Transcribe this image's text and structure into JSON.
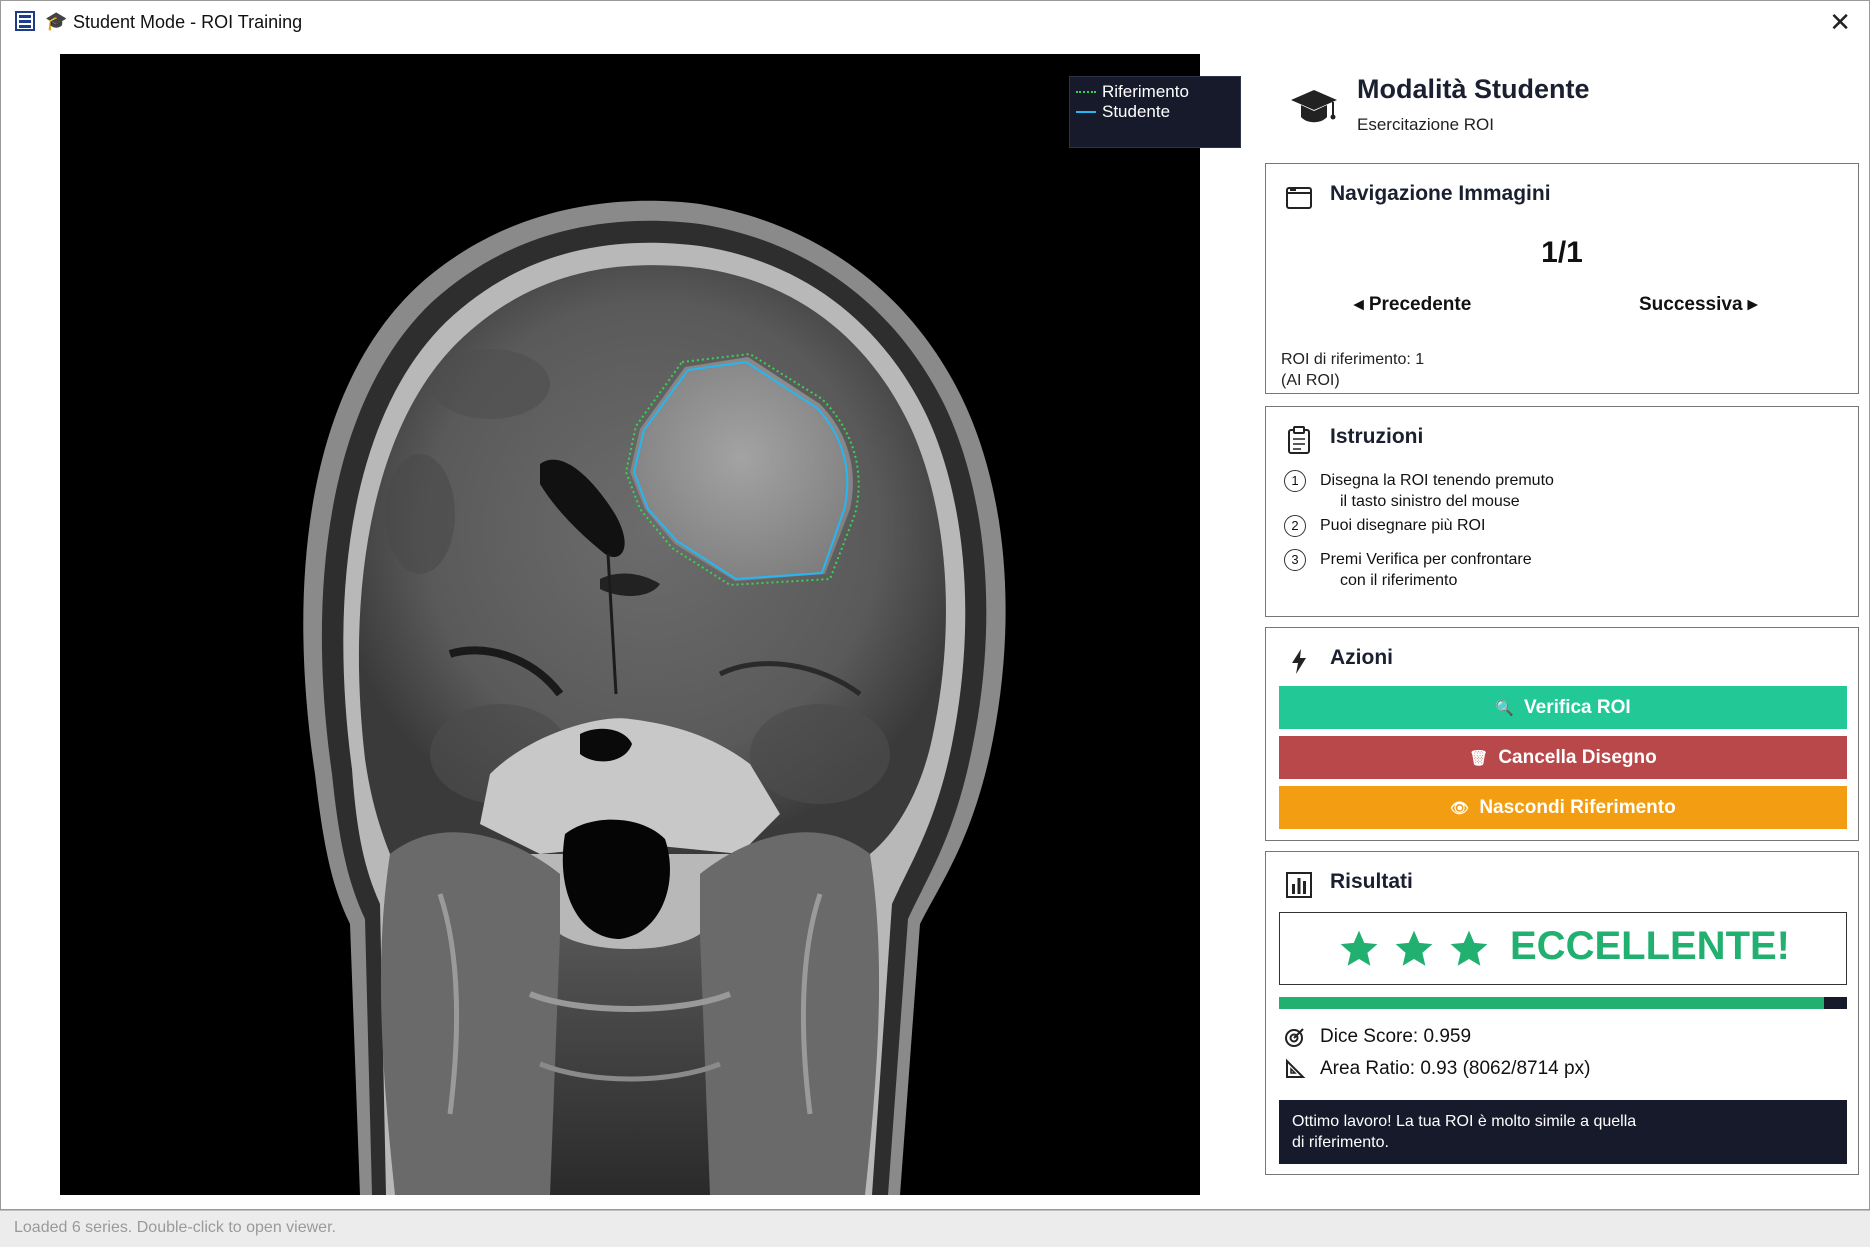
{
  "window": {
    "title": "Student Mode - ROI Training",
    "title_icon": "graduation-cap-icon",
    "close_label": "✕"
  },
  "viewer": {
    "legend": {
      "reference_label": "Riferimento",
      "student_label": "Studente",
      "reference_color": "#39d353",
      "student_color": "#27b6f0"
    }
  },
  "header": {
    "title": "Modalità Studente",
    "subtitle": "Esercitazione ROI",
    "icon": "graduation-cap-icon"
  },
  "navigation": {
    "title": "Navigazione Immagini",
    "counter": "1/1",
    "prev_label": "◂  Precedente",
    "next_label": "Successiva  ▸",
    "roi_info_line1": "ROI di riferimento: 1",
    "roi_info_line2": "(AI ROI)"
  },
  "instructions": {
    "title": "Istruzioni",
    "steps": [
      {
        "num": "1",
        "line1": "Disegna la ROI tenendo premuto",
        "line2": "il tasto sinistro del mouse"
      },
      {
        "num": "2",
        "line1": "Puoi disegnare più ROI",
        "line2": ""
      },
      {
        "num": "3",
        "line1": "Premi Verifica per confrontare",
        "line2": "con il riferimento"
      }
    ]
  },
  "actions": {
    "title": "Azioni",
    "verify_label": "Verifica ROI",
    "clear_label": "Cancella Disegno",
    "hide_label": "Nascondi Riferimento",
    "verify_color": "#22c997",
    "clear_color": "#b9484a",
    "hide_color": "#f29d12"
  },
  "results": {
    "title": "Risultati",
    "stars": 3,
    "verdict": "ECCELLENTE!",
    "progress": 0.959,
    "dice_label": "Dice Score: 0.959",
    "area_label": "Area Ratio: 0.93 (8062/8714 px)",
    "message_line1": "Ottimo lavoro! La tua ROI è molto simile a quella",
    "message_line2": "di riferimento.",
    "accent_color": "#22b070"
  },
  "status": {
    "text": "Loaded 6 series. Double-click to open viewer."
  }
}
